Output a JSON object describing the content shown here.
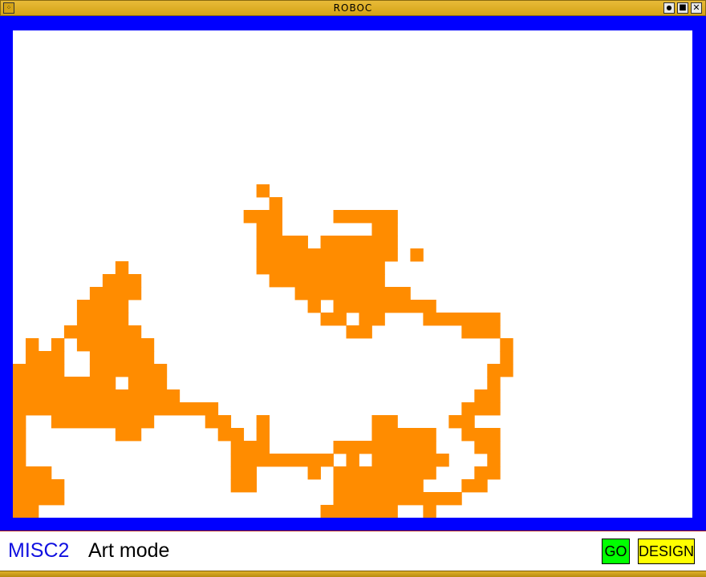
{
  "window": {
    "title": "ROBOC",
    "menu_icon": "window-menu-icon",
    "controls": [
      {
        "name": "iconify",
        "icon": "iconify-icon"
      },
      {
        "name": "maximize",
        "icon": "maximize-icon"
      },
      {
        "name": "close",
        "icon": "close-icon"
      }
    ]
  },
  "canvas": {
    "frame_color": "#0000ff",
    "background_color": "#ffffff",
    "paint_color": "#ff8c00",
    "grid_cols": 53,
    "grid_rows": 38,
    "cells": [
      "",
      "",
      "",
      "",
      "",
      "",
      "",
      "",
      "",
      "",
      "",
      "",
      "19-20",
      "20-21",
      "18-21,25-30",
      "19-21,28-30",
      "19-23,24-30",
      "19-30,31-32",
      "8-9,19-29",
      "7-10,20-21,21-29",
      "6-10,22-31",
      "5-9,23-24,25-33",
      "5-9,24-26,27-29,32-38",
      "4-10,26-28,35-38",
      "1-2,3-4,5-11,38-39",
      "1-4,6-11,38-39",
      "0-4,6-12,37-39",
      "0-8,9-12,37-38",
      "0-13,36-38",
      "0-16,35-38",
      "0-1,3-11,15-17,19-20,28-30,34-36",
      "0-1,8-10,16-18,19-20,28-33,35-38",
      "0-1,17-20,25-33,36-38",
      "0-1,17-25,26-27,28-34,37-38",
      "0-3,17-19,23-24,25-33,36-38",
      "0-4,17-19,25-32,35-37",
      "0-4,25-35",
      "0-2,24-30,32-33"
    ]
  },
  "status": {
    "program_name": "MISC2",
    "mode": "Art mode",
    "go_label": "GO",
    "design_label": "DESIGN"
  },
  "colors": {
    "titlebar": "#d4a316",
    "program_name": "#1010e0",
    "go": "#00ff00",
    "design": "#ffff00"
  }
}
